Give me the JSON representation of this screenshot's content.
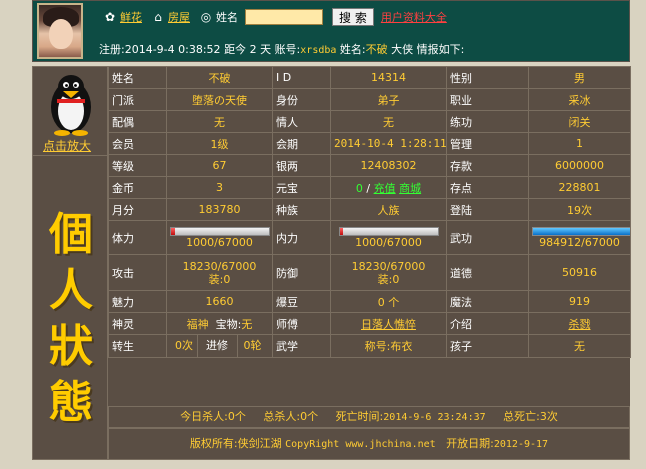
{
  "header": {
    "nav": [
      {
        "label": "鲜花",
        "icon": "flower-icon"
      },
      {
        "label": "房屋",
        "icon": "house-icon"
      }
    ],
    "search_label": "姓名",
    "search_value": "",
    "search_button": "搜 索",
    "directory_link": "用户资料大全",
    "info": {
      "reg_label": "注册:",
      "reg_time": "2014-9-4 0:38:52",
      "ago_label": "距今",
      "ago_value": "2",
      "ago_unit": "天",
      "account_label": "账号:",
      "account": "xrsdba",
      "name_label": "姓名:",
      "name": "不破",
      "suffix": "大侠 情报如下:"
    }
  },
  "sidebar": {
    "attack_link": "点击放大",
    "status_title": [
      "個",
      "人",
      "狀",
      "態"
    ]
  },
  "stats": {
    "name_k": "姓名",
    "name_v": "不破",
    "id_k": "I D",
    "id_v": "14314",
    "gender_k": "性别",
    "gender_v": "男",
    "sect_k": "门派",
    "sect_v": "堕落の天使",
    "identity_k": "身份",
    "identity_v": "弟子",
    "job_k": "职业",
    "job_v": "采冰",
    "spouse_k": "配偶",
    "spouse_v": "无",
    "lover_k": "情人",
    "lover_v": "无",
    "training_k": "练功",
    "training_v": "闭关",
    "member_k": "会员",
    "member_v": "1级",
    "period_k": "会期",
    "period_v": "2014-10-4 1:28:11",
    "manage_k": "管理",
    "manage_v": "1",
    "level_k": "等级",
    "level_v": "67",
    "silver_k": "银两",
    "silver_v": "12408302",
    "deposit_k": "存款",
    "deposit_v": "6000000",
    "gold_k": "金币",
    "gold_v": "3",
    "yuanbao_k": "元宝",
    "yuanbao_v": "0",
    "yuanbao_sep": "/",
    "recharge_link": "充值",
    "mall_link": "商城",
    "points_k": "存点",
    "points_v": "228801",
    "monthly_k": "月分",
    "monthly_v": "183780",
    "race_k": "种族",
    "race_v": "人族",
    "login_k": "登陆",
    "login_v": "19次",
    "strength_k": "体力",
    "strength_v": "1000/67000",
    "strength_ratio": 0.0149,
    "inner_k": "内力",
    "inner_v": "1000/67000",
    "inner_ratio": 0.0149,
    "martial_k": "武功",
    "martial_v": "984912/67000",
    "martial_ratio": 1.0,
    "attack_k": "攻击",
    "attack_v": "18230/67000",
    "attack_equip": "装:0",
    "defense_k": "防御",
    "defense_v": "18230/67000",
    "defense_equip": "装:0",
    "moral_k": "道德",
    "moral_v": "50916",
    "charm_k": "魅力",
    "charm_v": "1660",
    "beans_k": "爆豆",
    "beans_v": "0 个",
    "magic_k": "魔法",
    "magic_v": "919",
    "spirit_k": "神灵",
    "spirit_v": "福神",
    "pet_k": "宝物:",
    "pet_v": "无",
    "master_k": "师傅",
    "master_v": "日落人憔悴",
    "intro_k": "介绍",
    "intro_v": "杀戮",
    "rebirth_k": "转生",
    "rebirth_v": "0次",
    "advance_k": "进修",
    "advance_v": "0轮",
    "skill_k": "武学",
    "title_label": "称号:",
    "title_v": "布衣",
    "child_k": "孩子",
    "child_v": "无"
  },
  "footer": {
    "kills_today": "今日杀人:0个",
    "kills_total": "总杀人:0个",
    "death_label": "死亡时间:",
    "death_time": "2014-9-6 23:24:37",
    "deaths_total": "总死亡:3次",
    "copyright_label": "版权所有:侠剑江湖",
    "copyright": "CopyRight www.jhchina.net",
    "open_label": "开放日期:",
    "open_date": "2012-9-17"
  },
  "colors": {
    "header_bg": "#0d4c44",
    "panel_bg": "#5a4e44",
    "value_text": "#ffcc33",
    "link_red": "#ff4040",
    "link_green": "#33ff33"
  }
}
